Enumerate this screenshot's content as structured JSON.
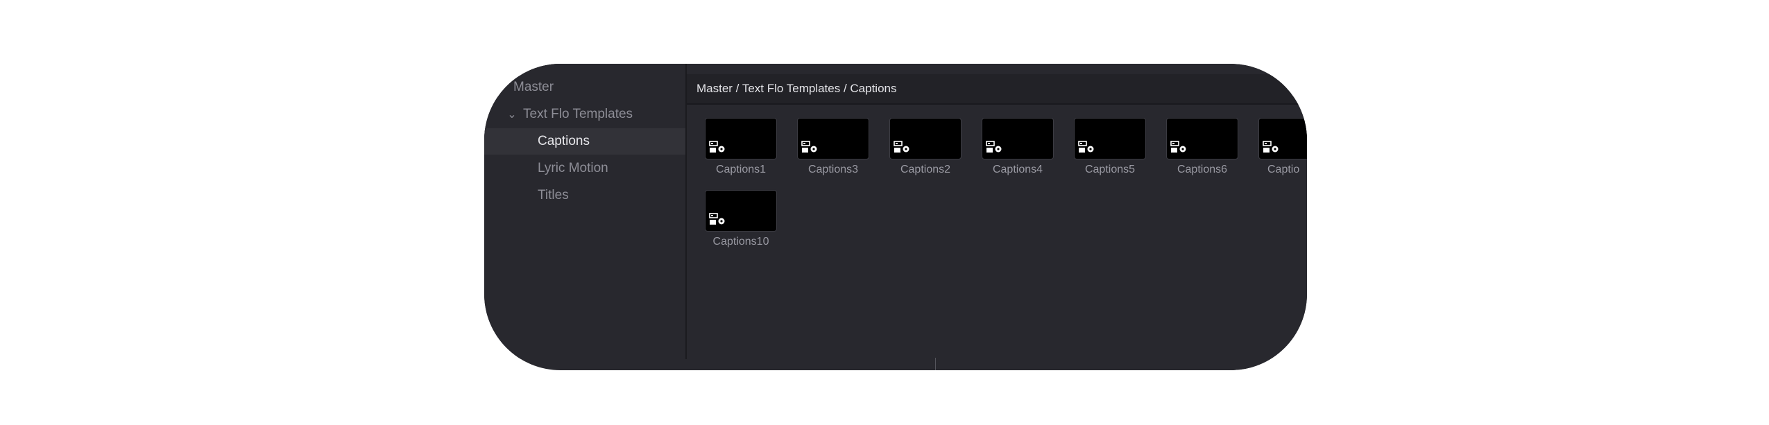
{
  "sidebar": {
    "root": "Master",
    "folder": {
      "label": "Text Flo Templates",
      "expanded": true,
      "children": [
        {
          "label": "Captions",
          "selected": true
        },
        {
          "label": "Lyric Motion",
          "selected": false
        },
        {
          "label": "Titles",
          "selected": false
        }
      ]
    }
  },
  "main": {
    "breadcrumb": "Master / Text Flo Templates / Captions",
    "clips": [
      {
        "name": "Captions1",
        "icon": "fusion-template-icon"
      },
      {
        "name": "Captions3",
        "icon": "fusion-template-icon"
      },
      {
        "name": "Captions2",
        "icon": "fusion-template-icon"
      },
      {
        "name": "Captions4",
        "icon": "fusion-template-icon"
      },
      {
        "name": "Captions5",
        "icon": "fusion-template-icon"
      },
      {
        "name": "Captions6",
        "icon": "fusion-template-icon"
      },
      {
        "name": "Captio",
        "icon": "fusion-template-icon"
      },
      {
        "name": "Captions10",
        "icon": "fusion-template-icon"
      }
    ]
  },
  "colors": {
    "panel_bg": "#28282e",
    "header_bg": "#222227",
    "selected_row": "#323238",
    "thumb_bg": "#000000"
  }
}
